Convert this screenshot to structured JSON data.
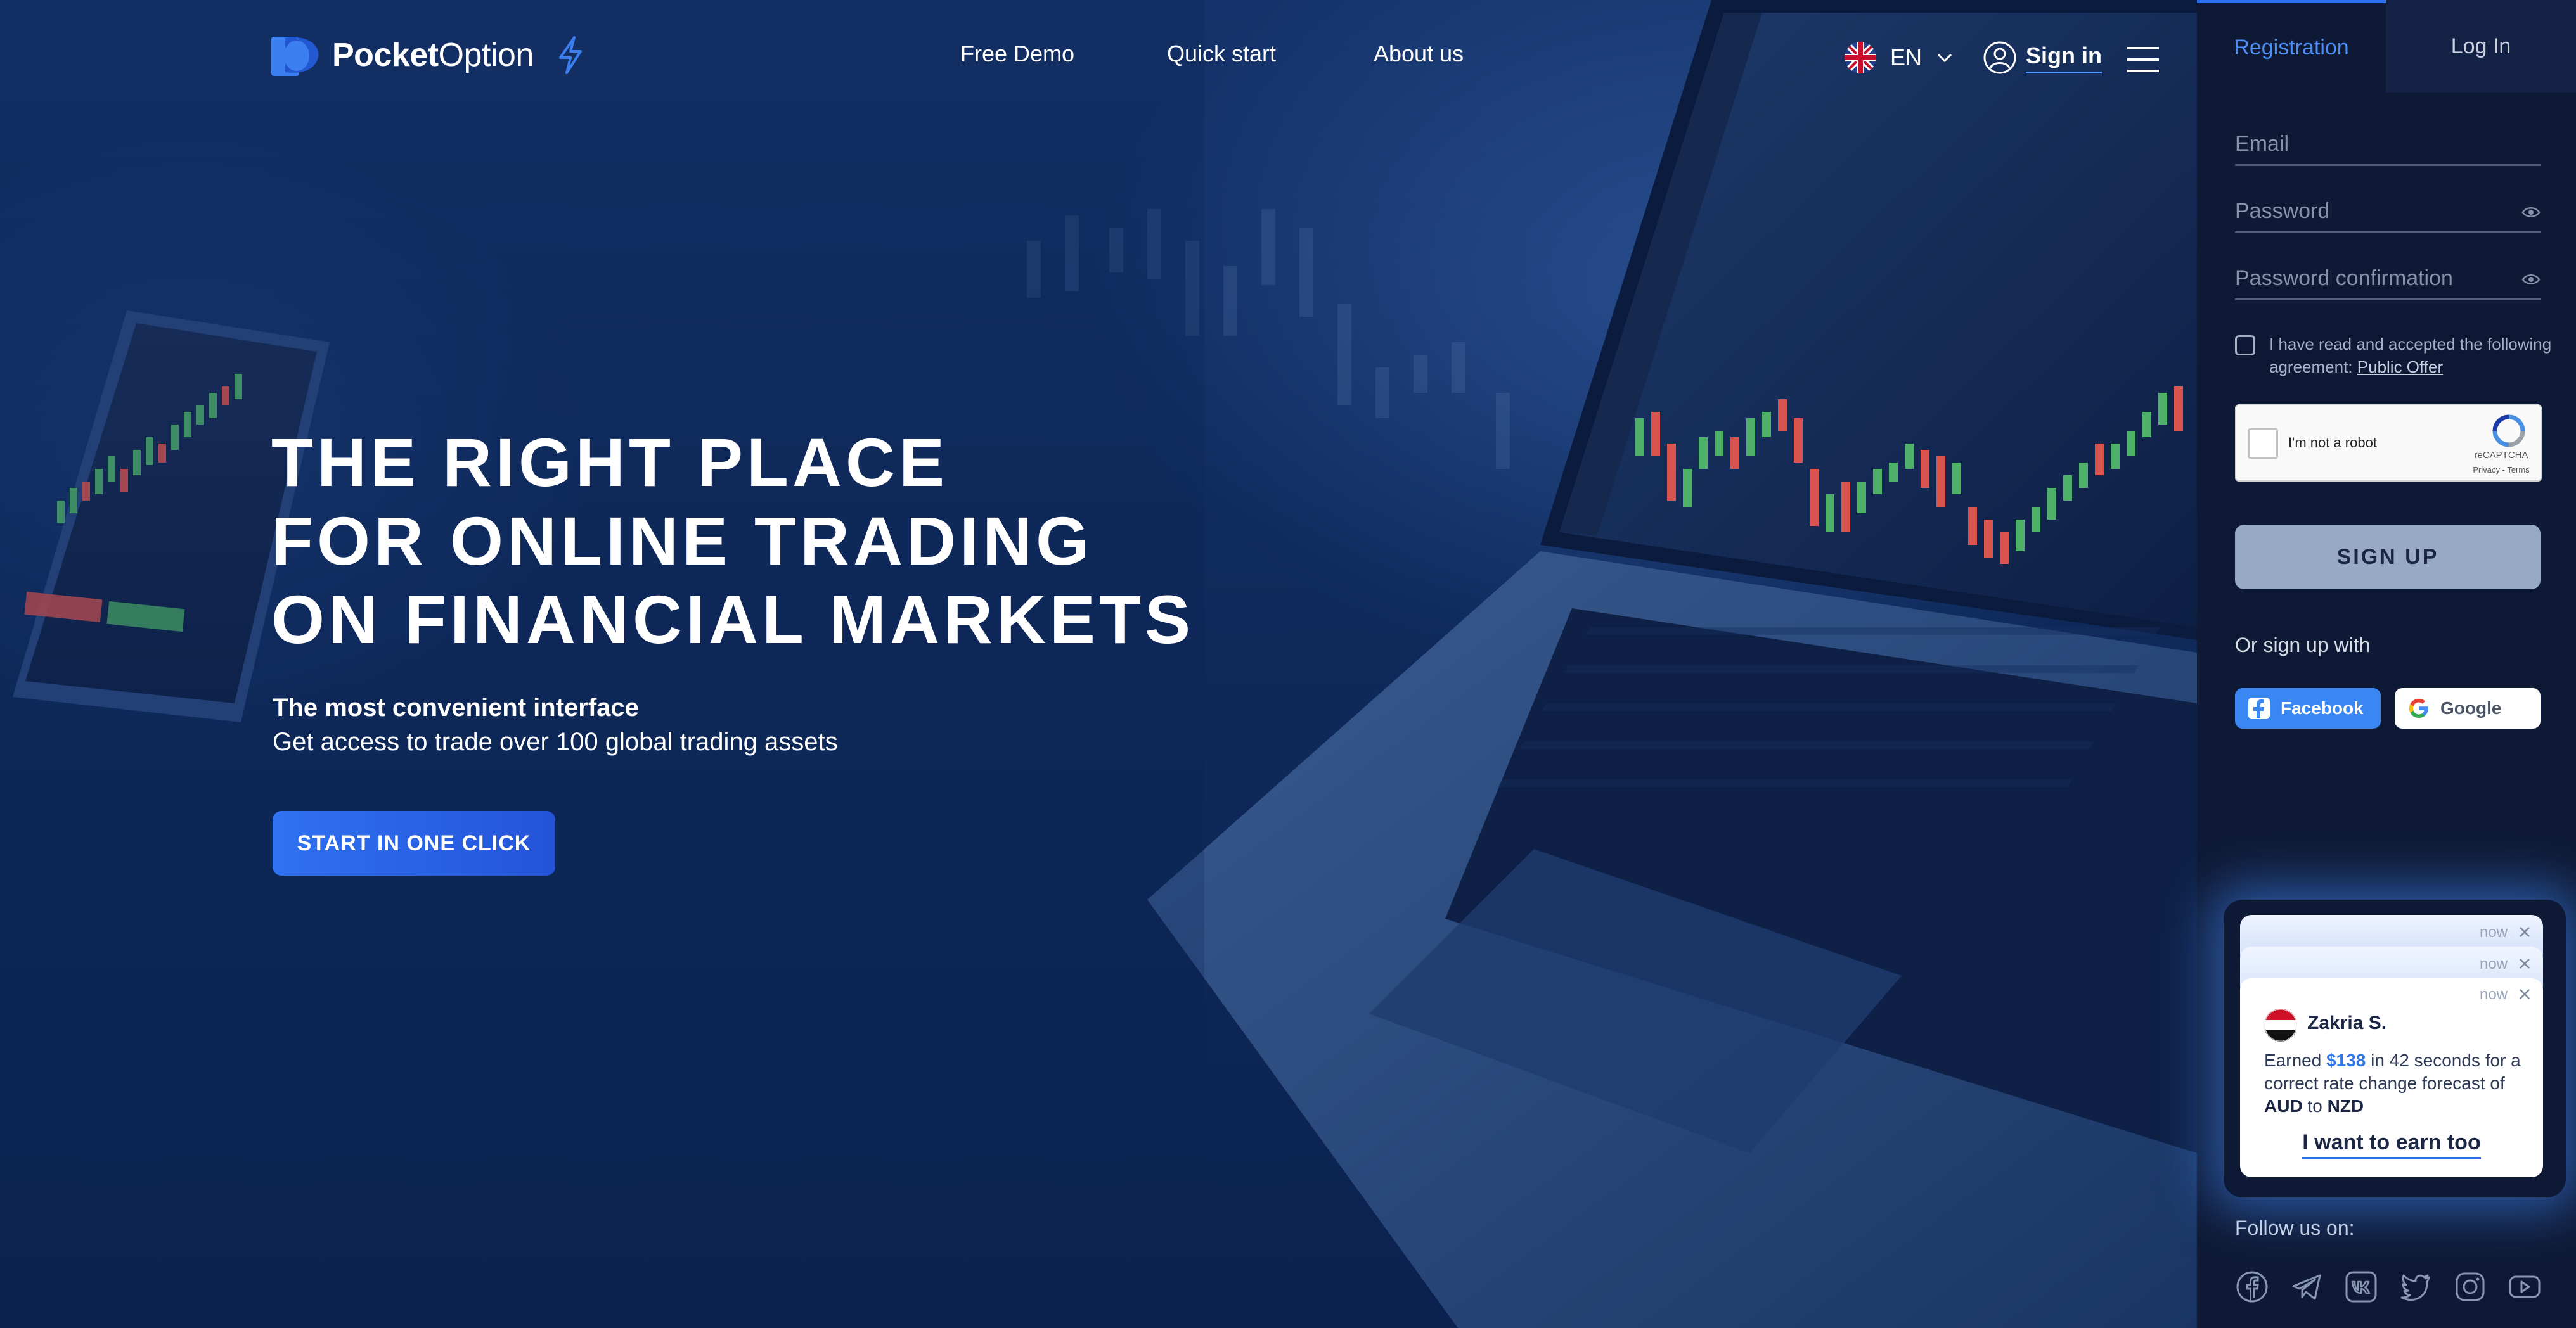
{
  "brand": {
    "name_bold": "Pocket",
    "name_thin": "Option"
  },
  "nav": {
    "items": [
      "Free Demo",
      "Quick start",
      "About us"
    ]
  },
  "header": {
    "language": "EN",
    "signin_label": "Sign in"
  },
  "hero": {
    "headline": [
      "THE RIGHT PLACE",
      "FOR ONLINE TRADING",
      "ON FINANCIAL MARKETS"
    ],
    "subtitle_bold": "The most convenient interface",
    "subtitle": "Get access to trade over 100 global trading assets",
    "cta_label": "START IN ONE CLICK"
  },
  "sidebar": {
    "tab_registration": "Registration",
    "tab_login": "Log In",
    "email_placeholder": "Email",
    "password_placeholder": "Password",
    "password_confirm_placeholder": "Password confirmation",
    "agreement_text": "I have read and accepted the following agreement:",
    "agreement_link": "Public Offer",
    "captcha_label": "I'm not a robot",
    "captcha_brand": "reCAPTCHA",
    "captcha_terms": "Privacy - Terms",
    "signup_label": "SIGN UP",
    "or_signup_with": "Or sign up with",
    "facebook_label": "Facebook",
    "google_label": "Google",
    "follow_us": "Follow us on:",
    "follow_icons": [
      "facebook-icon",
      "telegram-icon",
      "vk-icon",
      "twitter-icon",
      "instagram-icon",
      "youtube-icon"
    ]
  },
  "notification": {
    "time_labels": [
      "now",
      "now",
      "now"
    ],
    "name": "Zakria S.",
    "earned_prefix": "Earned",
    "amount": "$138",
    "earned_suffix": "in 42 seconds for a correct rate change forecast of",
    "asset_from": "AUD",
    "to_word": "to",
    "asset_to": "NZD",
    "cta_label": "I want to earn too"
  },
  "colors": {
    "accent": "#2f6fea",
    "background": "#0f2a5c",
    "sidebar": "#0e1a35",
    "candle_up": "#4fb06a",
    "candle_down": "#d9534f"
  }
}
